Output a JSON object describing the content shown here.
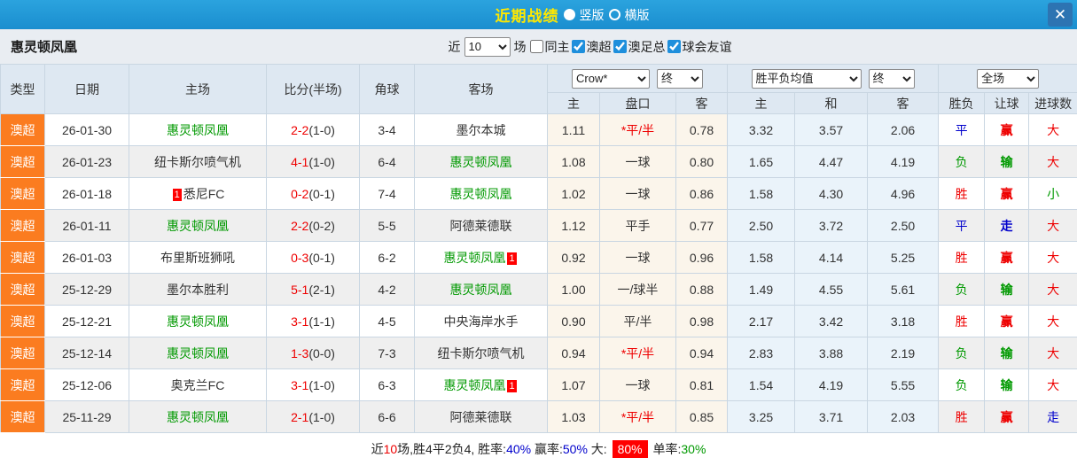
{
  "palette": {
    "titlebar_blue": "#1e98d8",
    "title_yellow": "#ffe800",
    "league_orange": "#fb7c20",
    "win_red": "#e00000",
    "lose_green": "#009900",
    "draw_blue": "#0000cc",
    "header_bg": "#dee8f2",
    "crow_col_bg": "#fbf5eb",
    "avg_col_bg": "#eaf3fa"
  },
  "titlebar": {
    "title": "近期战绩",
    "vertical_label": "竖版",
    "horizontal_label": "横版",
    "close_glyph": "✕"
  },
  "toolbar": {
    "team": "惠灵顿凤凰",
    "near": "近",
    "count": "10",
    "games": "场",
    "filters": [
      {
        "label": "同主",
        "checked": false
      },
      {
        "label": "澳超",
        "checked": true
      },
      {
        "label": "澳足总",
        "checked": true
      },
      {
        "label": "球会友谊",
        "checked": true
      }
    ]
  },
  "table": {
    "headers": {
      "type": "类型",
      "date": "日期",
      "home": "主场",
      "score": "比分(半场)",
      "corner": "角球",
      "away": "客场",
      "crow_select": "Crow*",
      "crow_final": "终",
      "avg_select": "胜平负均值",
      "avg_final": "终",
      "scope_select": "全场",
      "h_home": "主",
      "h_handicap": "盘口",
      "h_away": "客",
      "a_home": "主",
      "a_draw": "和",
      "a_away": "客",
      "spf": "胜负",
      "rq": "让球",
      "jq": "进球数"
    },
    "rows": [
      {
        "league": "澳超",
        "date": "26-01-30",
        "home": "惠灵顿凤凰",
        "home_cls": "c-green",
        "home_badge": "",
        "score": "2-2",
        "half": "(1-0)",
        "corner": "3-4",
        "away": "墨尔本城",
        "away_cls": "",
        "away_badge": "",
        "crow_home": "1.11",
        "pan": "*平/半",
        "pan_cls": "c-red",
        "crow_away": "0.78",
        "avg_home": "3.32",
        "avg_draw": "3.57",
        "avg_away": "2.06",
        "spf": "平",
        "spf_cls": "c-blue",
        "rq": "赢",
        "rq_cls": "c-red",
        "jq": "大",
        "jq_cls": "c-red"
      },
      {
        "league": "澳超",
        "date": "26-01-23",
        "home": "纽卡斯尔喷气机",
        "home_cls": "",
        "home_badge": "",
        "score": "4-1",
        "half": "(1-0)",
        "corner": "6-4",
        "away": "惠灵顿凤凰",
        "away_cls": "c-green",
        "away_badge": "",
        "crow_home": "1.08",
        "pan": "一球",
        "pan_cls": "",
        "crow_away": "0.80",
        "avg_home": "1.65",
        "avg_draw": "4.47",
        "avg_away": "4.19",
        "spf": "负",
        "spf_cls": "c-green",
        "rq": "输",
        "rq_cls": "c-green",
        "jq": "大",
        "jq_cls": "c-red"
      },
      {
        "league": "澳超",
        "date": "26-01-18",
        "home": "悉尼FC",
        "home_cls": "",
        "home_badge": "1",
        "score": "0-2",
        "half": "(0-1)",
        "corner": "7-4",
        "away": "惠灵顿凤凰",
        "away_cls": "c-green",
        "away_badge": "",
        "crow_home": "1.02",
        "pan": "一球",
        "pan_cls": "",
        "crow_away": "0.86",
        "avg_home": "1.58",
        "avg_draw": "4.30",
        "avg_away": "4.96",
        "spf": "胜",
        "spf_cls": "c-red",
        "rq": "赢",
        "rq_cls": "c-red",
        "jq": "小",
        "jq_cls": "c-green"
      },
      {
        "league": "澳超",
        "date": "26-01-11",
        "home": "惠灵顿凤凰",
        "home_cls": "c-green",
        "home_badge": "",
        "score": "2-2",
        "half": "(0-2)",
        "corner": "5-5",
        "away": "阿德莱德联",
        "away_cls": "",
        "away_badge": "",
        "crow_home": "1.12",
        "pan": "平手",
        "pan_cls": "",
        "crow_away": "0.77",
        "avg_home": "2.50",
        "avg_draw": "3.72",
        "avg_away": "2.50",
        "spf": "平",
        "spf_cls": "c-blue",
        "rq": "走",
        "rq_cls": "c-blue",
        "jq": "大",
        "jq_cls": "c-red"
      },
      {
        "league": "澳超",
        "date": "26-01-03",
        "home": "布里斯班狮吼",
        "home_cls": "",
        "home_badge": "",
        "score": "0-3",
        "half": "(0-1)",
        "corner": "6-2",
        "away": "惠灵顿凤凰",
        "away_cls": "c-green",
        "away_badge": "1",
        "crow_home": "0.92",
        "pan": "一球",
        "pan_cls": "",
        "crow_away": "0.96",
        "avg_home": "1.58",
        "avg_draw": "4.14",
        "avg_away": "5.25",
        "spf": "胜",
        "spf_cls": "c-red",
        "rq": "赢",
        "rq_cls": "c-red",
        "jq": "大",
        "jq_cls": "c-red"
      },
      {
        "league": "澳超",
        "date": "25-12-29",
        "home": "墨尔本胜利",
        "home_cls": "",
        "home_badge": "",
        "score": "5-1",
        "half": "(2-1)",
        "corner": "4-2",
        "away": "惠灵顿凤凰",
        "away_cls": "c-green",
        "away_badge": "",
        "crow_home": "1.00",
        "pan": "一/球半",
        "pan_cls": "",
        "crow_away": "0.88",
        "avg_home": "1.49",
        "avg_draw": "4.55",
        "avg_away": "5.61",
        "spf": "负",
        "spf_cls": "c-green",
        "rq": "输",
        "rq_cls": "c-green",
        "jq": "大",
        "jq_cls": "c-red"
      },
      {
        "league": "澳超",
        "date": "25-12-21",
        "home": "惠灵顿凤凰",
        "home_cls": "c-green",
        "home_badge": "",
        "score": "3-1",
        "half": "(1-1)",
        "corner": "4-5",
        "away": "中央海岸水手",
        "away_cls": "",
        "away_badge": "",
        "crow_home": "0.90",
        "pan": "平/半",
        "pan_cls": "",
        "crow_away": "0.98",
        "avg_home": "2.17",
        "avg_draw": "3.42",
        "avg_away": "3.18",
        "spf": "胜",
        "spf_cls": "c-red",
        "rq": "赢",
        "rq_cls": "c-red",
        "jq": "大",
        "jq_cls": "c-red"
      },
      {
        "league": "澳超",
        "date": "25-12-14",
        "home": "惠灵顿凤凰",
        "home_cls": "c-green",
        "home_badge": "",
        "score": "1-3",
        "half": "(0-0)",
        "corner": "7-3",
        "away": "纽卡斯尔喷气机",
        "away_cls": "",
        "away_badge": "",
        "crow_home": "0.94",
        "pan": "*平/半",
        "pan_cls": "c-red",
        "crow_away": "0.94",
        "avg_home": "2.83",
        "avg_draw": "3.88",
        "avg_away": "2.19",
        "spf": "负",
        "spf_cls": "c-green",
        "rq": "输",
        "rq_cls": "c-green",
        "jq": "大",
        "jq_cls": "c-red"
      },
      {
        "league": "澳超",
        "date": "25-12-06",
        "home": "奥克兰FC",
        "home_cls": "",
        "home_badge": "",
        "score": "3-1",
        "half": "(1-0)",
        "corner": "6-3",
        "away": "惠灵顿凤凰",
        "away_cls": "c-green",
        "away_badge": "1",
        "crow_home": "1.07",
        "pan": "一球",
        "pan_cls": "",
        "crow_away": "0.81",
        "avg_home": "1.54",
        "avg_draw": "4.19",
        "avg_away": "5.55",
        "spf": "负",
        "spf_cls": "c-green",
        "rq": "输",
        "rq_cls": "c-green",
        "jq": "大",
        "jq_cls": "c-red"
      },
      {
        "league": "澳超",
        "date": "25-11-29",
        "home": "惠灵顿凤凰",
        "home_cls": "c-green",
        "home_badge": "",
        "score": "2-1",
        "half": "(1-0)",
        "corner": "6-6",
        "away": "阿德莱德联",
        "away_cls": "",
        "away_badge": "",
        "crow_home": "1.03",
        "pan": "*平/半",
        "pan_cls": "c-red",
        "crow_away": "0.85",
        "avg_home": "3.25",
        "avg_draw": "3.71",
        "avg_away": "2.03",
        "spf": "胜",
        "spf_cls": "c-red",
        "rq": "赢",
        "rq_cls": "c-red",
        "jq": "走",
        "jq_cls": "c-blue"
      }
    ]
  },
  "footer": {
    "segments": [
      {
        "text": "近",
        "cls": ""
      },
      {
        "text": "10",
        "cls": "c-red"
      },
      {
        "text": "场,胜4平2负4, 胜率:",
        "cls": ""
      },
      {
        "text": "40%",
        "cls": "c-blue"
      },
      {
        "text": " 赢率:",
        "cls": ""
      },
      {
        "text": "50%",
        "cls": "c-blue"
      },
      {
        "text": " 大: ",
        "cls": ""
      },
      {
        "text": "80%",
        "cls": "badge-red"
      },
      {
        "text": " 单率:",
        "cls": ""
      },
      {
        "text": "30%",
        "cls": "c-green"
      }
    ]
  }
}
